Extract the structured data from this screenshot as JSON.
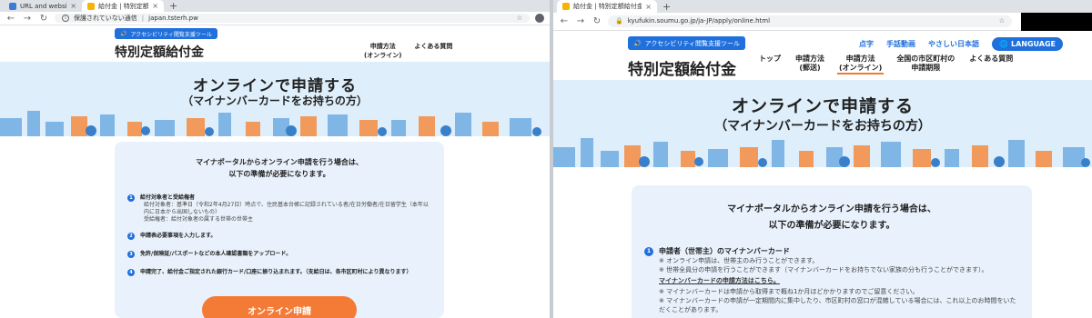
{
  "left": {
    "tabs": [
      {
        "title": "URL and website scanner",
        "favicon_color": "#3a7bd5"
      },
      {
        "title": "給付金 | 特別定額給付金",
        "favicon_color": "#f4b400"
      }
    ],
    "address": {
      "security": "保護されていない通信",
      "url": "japan.tsterh.pw"
    },
    "site": {
      "accessibility_label": "アクセシビリティ閲覧支援ツール",
      "brand": "特別定額給付金",
      "nav": [
        {
          "line1": "申請方法",
          "line2": "(オンライン)"
        },
        {
          "line1": "よくある質問",
          "line2": ""
        }
      ],
      "hero_title": "オンラインで申請する",
      "hero_subtitle": "（マイナンバーカードをお持ちの方）",
      "intro_line1": "マイナポータルからオンライン申請を行う場合は、",
      "intro_line2": "以下の準備が必要になります。",
      "steps": [
        {
          "num": "1",
          "head": "給付対象者と受給権者",
          "notes": [
            "給付対象者：基準日（令和2年4月27日）時点で、住民基本台帳に記録されている者/在日労働者/在日留学生（本年以内に日本から出国しないもの）",
            "受給権者：給付対象者の属する世帯の世帯主"
          ]
        },
        {
          "num": "2",
          "head": "申請表必要事項を入力します。",
          "notes": []
        },
        {
          "num": "3",
          "head": "免許/保険証/パスポートなどの本人確認書類をアップロード。",
          "notes": []
        },
        {
          "num": "4",
          "head": "申請完了、給付金ご指定された銀行カード/口座に振り込まれます。（支給日は、各市区町村により異なります）",
          "notes": []
        }
      ],
      "apply_button": "オンライン申請"
    }
  },
  "right": {
    "tabs": [
      {
        "title": "給付金 | 特別定額給付金 | オンライン",
        "favicon_color": "#f4b400"
      }
    ],
    "address": {
      "url": "kyufukin.soumu.go.jp/ja-JP/apply/online.html"
    },
    "site": {
      "accessibility_label": "アクセシビリティ閲覧支援ツール",
      "brand": "特別定額給付金",
      "subnav": [
        "点字",
        "手話動画",
        "やさしい日本語"
      ],
      "language_button": "LANGUAGE",
      "nav": [
        {
          "line1": "トップ",
          "line2": ""
        },
        {
          "line1": "申請方法",
          "line2": "(郵送)"
        },
        {
          "line1": "申請方法",
          "line2": "(オンライン)"
        },
        {
          "line1": "全国の市区町村の",
          "line2": "申請期限"
        },
        {
          "line1": "よくある質問",
          "line2": ""
        }
      ],
      "hero_title": "オンラインで申請する",
      "hero_subtitle": "（マイナンバーカードをお持ちの方）",
      "intro_line1": "マイナポータルからオンライン申請を行う場合は、",
      "intro_line2": "以下の準備が必要になります。",
      "step1": {
        "num": "1",
        "head": "申請者（世帯主）のマイナンバーカード",
        "notes": [
          "※ オンライン申請は、世帯主のみ行うことができます。",
          "※ 世帯全員分の申請を行うことができます（マイナンバーカードをお持ちでない家族の分も行うことができます）。"
        ],
        "link": "マイナンバーカードの申請方法はこちら。",
        "notes2": [
          "※ マイナンバーカードは申請から取得まで概ね1か月ほどかかりますのでご留意ください。",
          "※ マイナンバーカードの申請が一定期間内に集中したり、市区町村の窓口が混雑している場合には、これ以上のお時間をいただくことがあります。"
        ]
      }
    }
  },
  "colors": {
    "accent": "#1f6fdc",
    "orange": "#f47b36",
    "hero_bg": "#deeefa",
    "card_bg": "#e9f2fc"
  }
}
